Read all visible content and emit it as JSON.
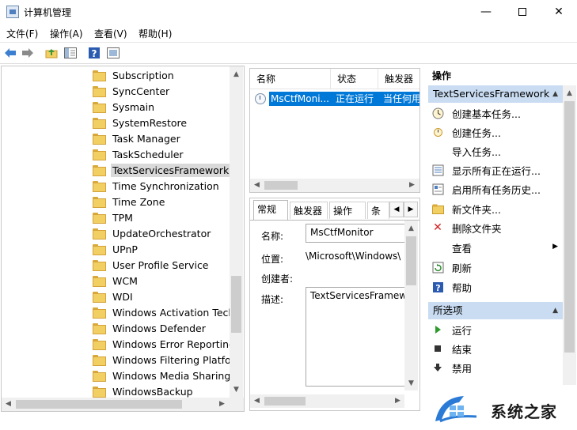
{
  "window": {
    "title": "计算机管理"
  },
  "menu": [
    "文件(F)",
    "操作(A)",
    "查看(V)",
    "帮助(H)"
  ],
  "toolbar": {
    "icons": [
      "back-arrow-icon",
      "forward-arrow-icon",
      "up-folder-icon",
      "show-tree-icon",
      "help-icon",
      "properties-icon"
    ]
  },
  "tree": {
    "items": [
      "Subscription",
      "SyncCenter",
      "Sysmain",
      "SystemRestore",
      "Task Manager",
      "TaskScheduler",
      "TextServicesFramework",
      "Time Synchronization",
      "Time Zone",
      "TPM",
      "UpdateOrchestrator",
      "UPnP",
      "User Profile Service",
      "WCM",
      "WDI",
      "Windows Activation Techn",
      "Windows Defender",
      "Windows Error Reporting",
      "Windows Filtering Platforr",
      "Windows Media Sharing",
      "WindowsBackup"
    ],
    "selected": "TextServicesFramework"
  },
  "task_list": {
    "columns": [
      "名称",
      "状态",
      "触发器"
    ],
    "rows": [
      {
        "name": "MsCtfMoni...",
        "status": "正在运行",
        "trigger": "当任何用"
      }
    ]
  },
  "properties": {
    "tabs": [
      "常规",
      "触发器",
      "操作",
      "条件"
    ],
    "active_tab": "常规",
    "name_label": "名称:",
    "name_value": "MsCtfMonitor",
    "location_label": "位置:",
    "location_value": "\\Microsoft\\Windows\\",
    "author_label": "创建者:",
    "description_label": "描述:",
    "description_value": "TextServicesFramew"
  },
  "actions": {
    "title": "操作",
    "section1": {
      "header": "TextServicesFramework",
      "items": [
        {
          "label": "创建基本任务...",
          "icon": "create-basic-task-icon"
        },
        {
          "label": "创建任务...",
          "icon": "create-task-icon"
        },
        {
          "label": "导入任务...",
          "icon": ""
        },
        {
          "label": "显示所有正在运行...",
          "icon": "running-tasks-icon"
        },
        {
          "label": "启用所有任务历史...",
          "icon": "task-history-icon"
        },
        {
          "label": "新文件夹...",
          "icon": "new-folder-icon"
        },
        {
          "label": "删除文件夹",
          "icon": "delete-icon"
        },
        {
          "label": "查看",
          "icon": ""
        },
        {
          "label": "刷新",
          "icon": "refresh-icon"
        },
        {
          "label": "帮助",
          "icon": "help-icon"
        }
      ]
    },
    "section2": {
      "header": "所选项",
      "items": [
        {
          "label": "运行",
          "icon": "run-icon"
        },
        {
          "label": "结束",
          "icon": "stop-icon"
        },
        {
          "label": "禁用",
          "icon": "disable-icon"
        }
      ]
    }
  },
  "watermark": {
    "text": "系统之家"
  },
  "colors": {
    "selection": "#0078d7",
    "section_header": "#c9dcf2",
    "folder": "#f2cf63"
  }
}
